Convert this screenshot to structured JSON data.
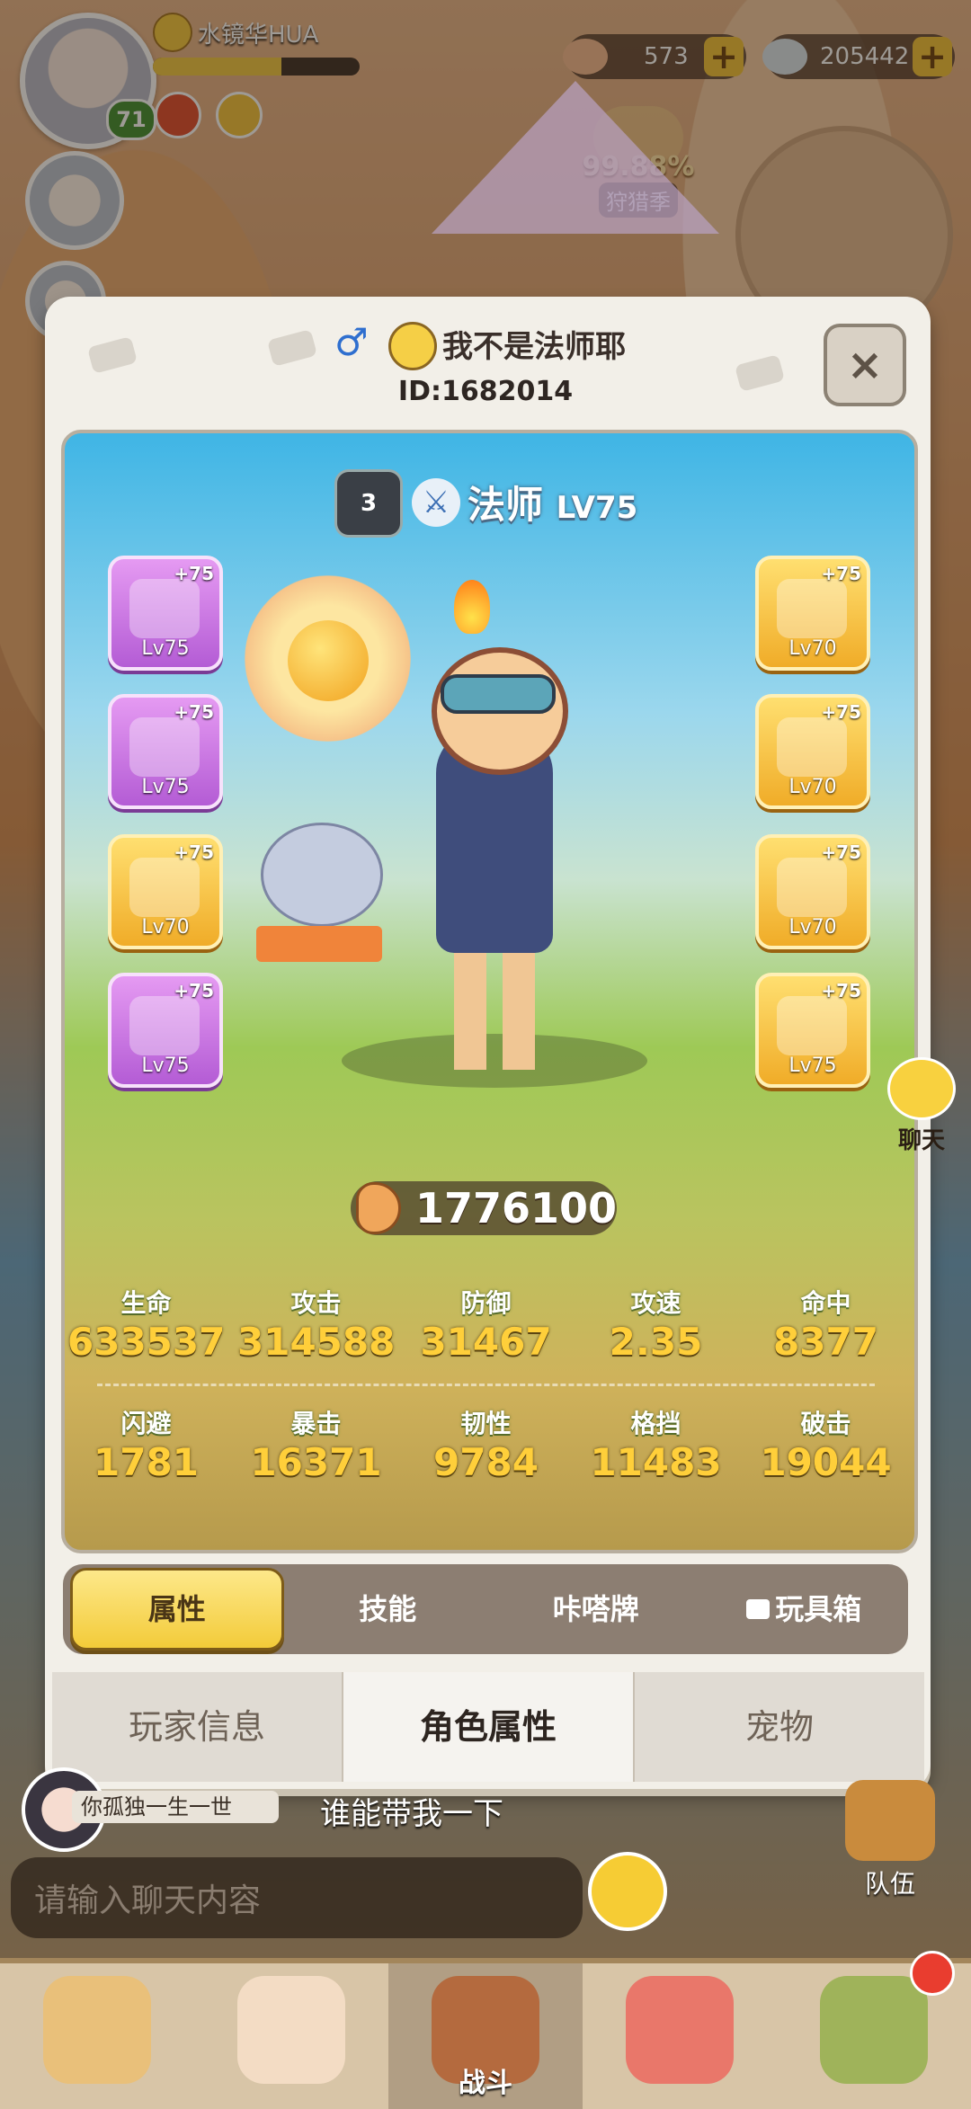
{
  "player": {
    "name": "水镜华HUA",
    "level": "71",
    "xp_fraction": 0.62
  },
  "resources": [
    {
      "icon": "shell-icon",
      "value": "573"
    },
    {
      "icon": "pearl-icon",
      "value": "205442"
    }
  ],
  "season": {
    "percent": "99.88%",
    "label": "狩猎季"
  },
  "profile": {
    "name": "我不是法师耶",
    "id": "ID:1682014",
    "gender_icon": "♂",
    "close_label": "×",
    "rank": "3",
    "class_name": "法师",
    "class_level": "LV75",
    "class_icon": "⚔"
  },
  "equipment_left": [
    {
      "plus": "+75",
      "level": "Lv75",
      "rarity": "purple"
    },
    {
      "plus": "+75",
      "level": "Lv75",
      "rarity": "purple"
    },
    {
      "plus": "+75",
      "level": "Lv70",
      "rarity": "gold"
    },
    {
      "plus": "+75",
      "level": "Lv75",
      "rarity": "purple"
    }
  ],
  "equipment_right": [
    {
      "plus": "+75",
      "level": "Lv70",
      "rarity": "gold"
    },
    {
      "plus": "+75",
      "level": "Lv70",
      "rarity": "gold"
    },
    {
      "plus": "+75",
      "level": "Lv70",
      "rarity": "gold"
    },
    {
      "plus": "+75",
      "level": "Lv75",
      "rarity": "gold"
    }
  ],
  "power": "1776100",
  "stats_row1": [
    {
      "name": "生命",
      "value": "633537"
    },
    {
      "name": "攻击",
      "value": "314588"
    },
    {
      "name": "防御",
      "value": "31467"
    },
    {
      "name": "攻速",
      "value": "2.35"
    },
    {
      "name": "命中",
      "value": "8377"
    }
  ],
  "stats_row2": [
    {
      "name": "闪避",
      "value": "1781"
    },
    {
      "name": "暴击",
      "value": "16371"
    },
    {
      "name": "韧性",
      "value": "9784"
    },
    {
      "name": "格挡",
      "value": "11483"
    },
    {
      "name": "破击",
      "value": "19044"
    }
  ],
  "subtabs": [
    "属性",
    "技能",
    "咔嗒牌",
    "玩具箱"
  ],
  "bottom_tabs": [
    "玩家信息",
    "角色属性",
    "宠物"
  ],
  "chat": {
    "tag": "你孤独一生一世",
    "message": "谁能带我一下",
    "placeholder": "请输入聊天内容",
    "side_label": "聊天"
  },
  "team_label": "队伍",
  "dock": {
    "center_label": "战斗"
  },
  "colors": {
    "stat_value": "#ffcf3a",
    "active_tab": "#f3cb39",
    "panel": "#f2efe8"
  }
}
